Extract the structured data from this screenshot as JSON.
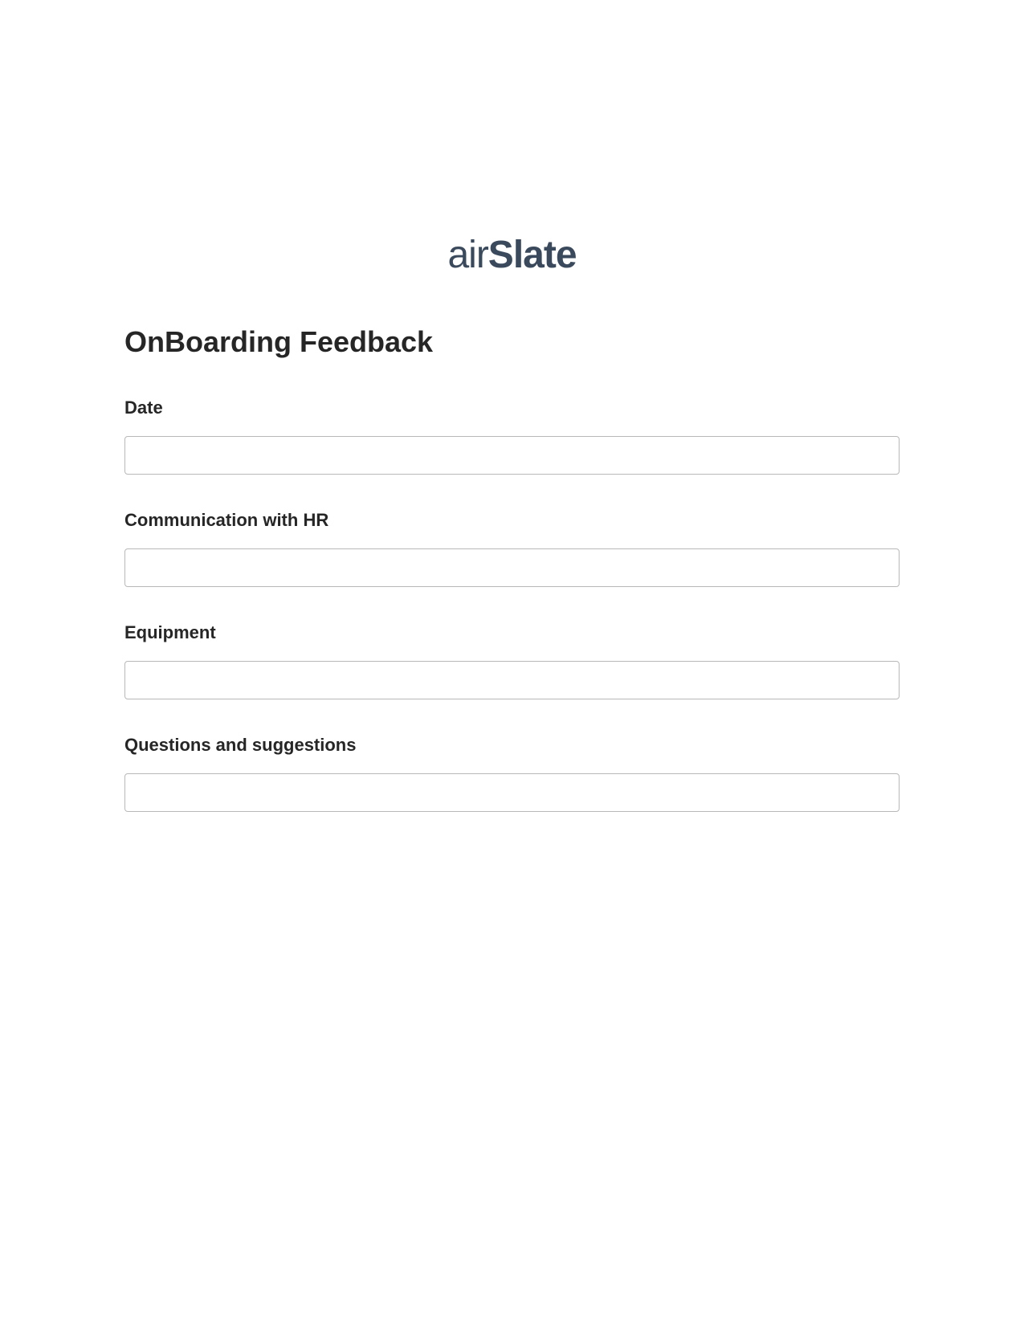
{
  "logo": {
    "part1": "air",
    "part2": "Slate"
  },
  "form": {
    "title": "OnBoarding Feedback",
    "fields": [
      {
        "label": "Date",
        "value": ""
      },
      {
        "label": "Communication with HR",
        "value": ""
      },
      {
        "label": "Equipment",
        "value": ""
      },
      {
        "label": "Questions and suggestions",
        "value": ""
      }
    ]
  }
}
